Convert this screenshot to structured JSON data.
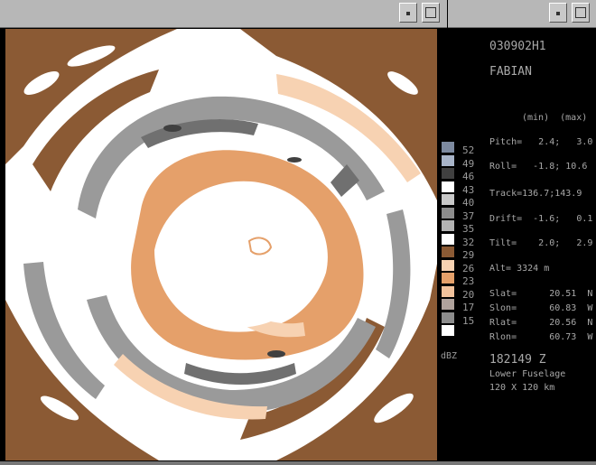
{
  "info": {
    "flight_id": "030902H1",
    "storm": "FABIAN",
    "minmax_header": "(min)  (max)",
    "pitch": "Pitch=   2.4;   3.0",
    "roll": "Roll=   -1.8; 10.6",
    "track": "Track=136.7;143.9",
    "drift": "Drift=  -1.6;   0.1",
    "tilt": "Tilt=    2.0;   2.9",
    "alt": "Alt= 3324 m",
    "slat": "Slat=      20.51  N",
    "slon": "Slon=      60.83  W",
    "rlat": "Rlat=      20.56  N",
    "rlon": "Rlon=      60.73  W",
    "time": "182149 Z",
    "radar": "Lower Fuselage",
    "range": "120 X 120 km"
  },
  "legend": {
    "unit": "dBZ",
    "entries": [
      {
        "label": "52",
        "color": "#7d8aa0"
      },
      {
        "label": "49",
        "color": "#a8b4c8"
      },
      {
        "label": "46",
        "color": "#404040"
      },
      {
        "label": "43",
        "color": "#ffffff"
      },
      {
        "label": "40",
        "color": "#c8c8c8"
      },
      {
        "label": "37",
        "color": "#8c8c8c"
      },
      {
        "label": "35",
        "color": "#b2b2b2"
      },
      {
        "label": "32",
        "color": "#ffffff"
      },
      {
        "label": "29",
        "color": "#8b5a34"
      },
      {
        "label": "26",
        "color": "#f7d2b2"
      },
      {
        "label": "23",
        "color": "#e5a06a"
      },
      {
        "label": "20",
        "color": "#f2c29c"
      },
      {
        "label": "17",
        "color": "#b0a29c"
      },
      {
        "label": "15",
        "color": "#8c8c8c"
      },
      {
        "label": "",
        "color": "#ffffff"
      }
    ]
  }
}
